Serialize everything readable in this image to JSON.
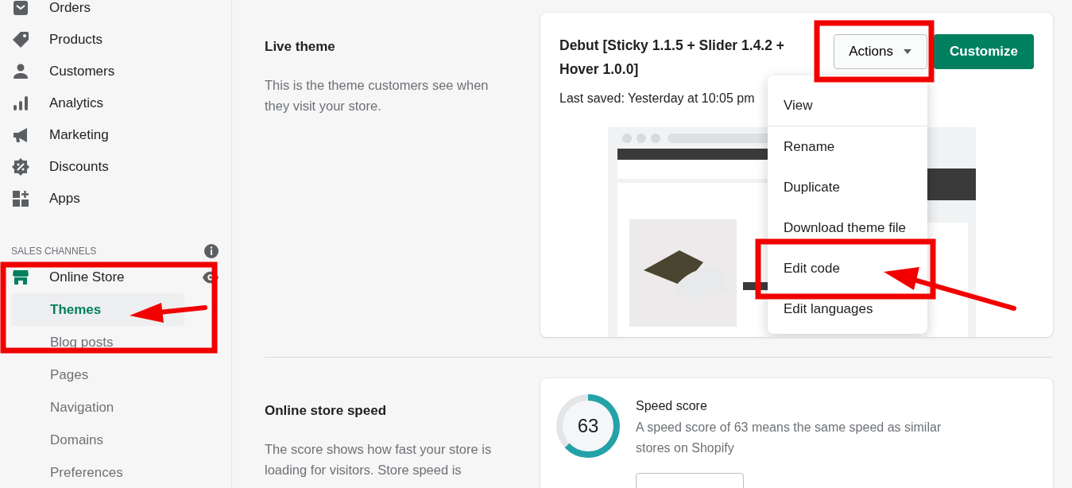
{
  "sidebar": {
    "items": [
      {
        "label": "Orders",
        "selected": false
      },
      {
        "label": "Products",
        "selected": false
      },
      {
        "label": "Customers",
        "selected": false
      },
      {
        "label": "Analytics",
        "selected": false
      },
      {
        "label": "Marketing",
        "selected": false
      },
      {
        "label": "Discounts",
        "selected": false
      },
      {
        "label": "Apps",
        "selected": false
      }
    ],
    "section_heading": "SALES CHANNELS",
    "channel": {
      "label": "Online Store",
      "children": [
        {
          "label": "Themes",
          "selected": true
        },
        {
          "label": "Blog posts",
          "selected": false
        },
        {
          "label": "Pages",
          "selected": false
        },
        {
          "label": "Navigation",
          "selected": false
        },
        {
          "label": "Domains",
          "selected": false
        },
        {
          "label": "Preferences",
          "selected": false
        }
      ]
    }
  },
  "live_theme": {
    "heading": "Live theme",
    "description": "This is the theme customers see when they visit your store.",
    "theme_name": "Debut [Sticky 1.1.5 + Slider 1.4.2 + Hover 1.0.0]",
    "last_saved": "Last saved: Yesterday at 10:05 pm",
    "actions_button": "Actions",
    "customize_button": "Customize",
    "menu": [
      {
        "label": "View"
      },
      {
        "label": "Rename"
      },
      {
        "label": "Duplicate"
      },
      {
        "label": "Download theme file"
      },
      {
        "label": "Edit code"
      },
      {
        "label": "Edit languages"
      }
    ]
  },
  "speed": {
    "heading": "Online store speed",
    "description": "The score shows how fast your store is loading for visitors. Store speed is",
    "score": "63",
    "level": 0.63,
    "title": "Speed score",
    "text": "A speed score of 63 means the same speed as similar stores on Shopify"
  }
}
